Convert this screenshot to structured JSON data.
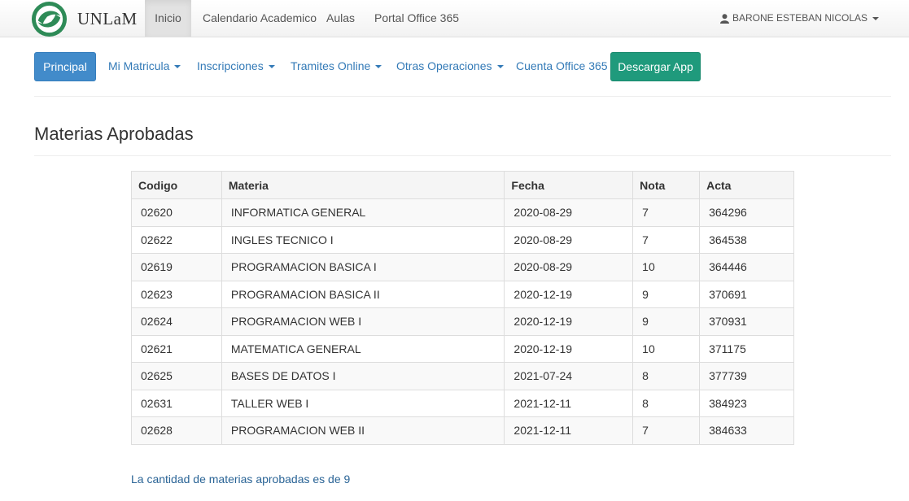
{
  "brand": {
    "name": "UNLaM",
    "logo_icon": "unlam-logo-icon"
  },
  "topnav": {
    "items": [
      "Inicio",
      "Calendario Academico",
      "Aulas",
      "Portal Office 365"
    ],
    "user": "BARONE ESTEBAN NICOLAS",
    "user_icon": "user-icon"
  },
  "menu": {
    "principal": "Principal",
    "matricula": "Mi Matricula",
    "inscripciones": "Inscripciones",
    "tramites": "Tramites Online",
    "otras": "Otras Operaciones",
    "cuenta": "Cuenta Office 365",
    "app": "Descargar App"
  },
  "colors": {
    "primary": "#428bca",
    "app_button": "#1f9a7c",
    "link": "#337ab7"
  },
  "page": {
    "title": "Materias Aprobadas"
  },
  "table": {
    "headers": [
      "Codigo",
      "Materia",
      "Fecha",
      "Nota",
      "Acta"
    ],
    "rows": [
      [
        "02620",
        "INFORMATICA GENERAL",
        "2020-08-29",
        "7",
        "364296"
      ],
      [
        "02622",
        "INGLES TECNICO I",
        "2020-08-29",
        "7",
        "364538"
      ],
      [
        "02619",
        "PROGRAMACION BASICA I",
        "2020-08-29",
        "10",
        "364446"
      ],
      [
        "02623",
        "PROGRAMACION BASICA II",
        "2020-12-19",
        "9",
        "370691"
      ],
      [
        "02624",
        "PROGRAMACION WEB I",
        "2020-12-19",
        "9",
        "370931"
      ],
      [
        "02621",
        "MATEMATICA GENERAL",
        "2020-12-19",
        "10",
        "371175"
      ],
      [
        "02625",
        "BASES DE DATOS I",
        "2021-07-24",
        "8",
        "377739"
      ],
      [
        "02631",
        "TALLER WEB I",
        "2021-12-11",
        "8",
        "384923"
      ],
      [
        "02628",
        "PROGRAMACION WEB II",
        "2021-12-11",
        "7",
        "384633"
      ]
    ]
  },
  "footer": {
    "note": "La cantidad de materias aprobadas es de 9"
  }
}
